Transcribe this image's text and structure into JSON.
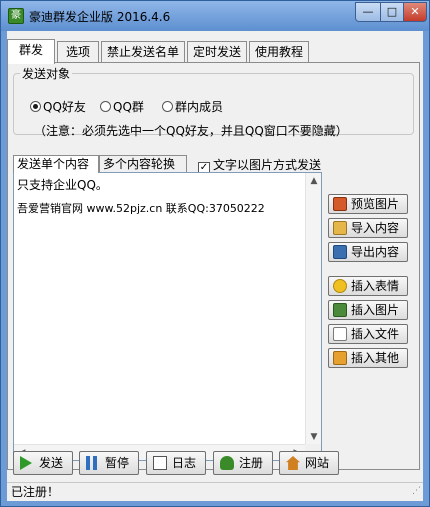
{
  "window": {
    "title": "豪迪群发企业版 2016.4.6",
    "minimize": "—",
    "maximize": "□",
    "close": "✕"
  },
  "tabs": [
    "群发",
    "选项",
    "禁止发送名单",
    "定时发送",
    "使用教程"
  ],
  "send_target": {
    "title": "发送对象",
    "options": [
      {
        "label": "QQ好友",
        "selected": true
      },
      {
        "label": "QQ群",
        "selected": false
      },
      {
        "label": "群内成员",
        "selected": false
      }
    ],
    "note": "（注意：必须先选中一个QQ好友，并且QQ窗口不要隐藏）"
  },
  "content_tabs": [
    "发送单个内容",
    "多个内容轮换"
  ],
  "image_mode": {
    "label": "文字以图片方式发送",
    "checked": true
  },
  "editor": {
    "lines": [
      "只支持企业QQ。",
      "吾爱营销官网 www.52pjz.cn 联系QQ:37050222"
    ]
  },
  "side_buttons": [
    {
      "label": "预览图片",
      "icon": "preview-image-icon",
      "color": "#d45a2a"
    },
    {
      "label": "导入内容",
      "icon": "folder-open-icon",
      "color": "#e5b64a"
    },
    {
      "label": "导出内容",
      "icon": "save-disk-icon",
      "color": "#3a6fb0"
    },
    {
      "label": "插入表情",
      "icon": "smiley-icon",
      "color": "#f0c020"
    },
    {
      "label": "插入图片",
      "icon": "picture-icon",
      "color": "#4a8a3a"
    },
    {
      "label": "插入文件",
      "icon": "file-icon",
      "color": "#ffffff"
    },
    {
      "label": "插入其他",
      "icon": "insert-other-icon",
      "color": "#e5a030"
    }
  ],
  "bottom_buttons": [
    {
      "label": "发送",
      "icon": "play-icon",
      "color": "#2f9a2a"
    },
    {
      "label": "暂停",
      "icon": "pause-icon",
      "color": "#2f6fc0"
    },
    {
      "label": "日志",
      "icon": "log-icon",
      "color": "#555555"
    },
    {
      "label": "注册",
      "icon": "user-icon",
      "color": "#3a8a2a"
    },
    {
      "label": "网站",
      "icon": "home-icon",
      "color": "#d08020"
    }
  ],
  "status": "已注册！"
}
